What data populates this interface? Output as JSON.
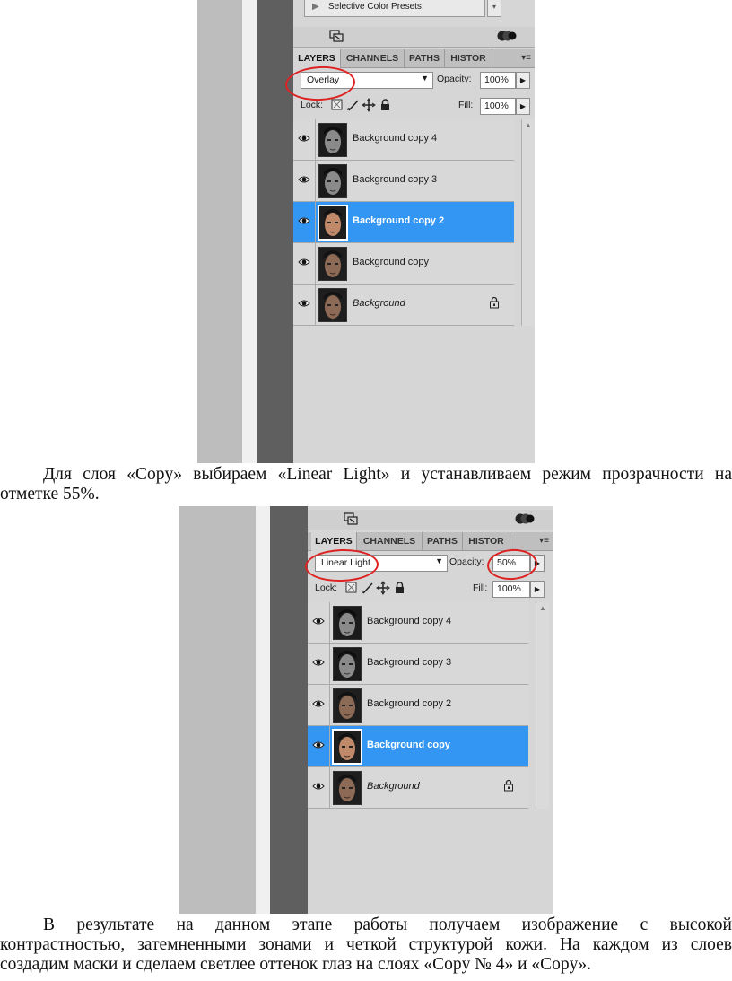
{
  "screenshot1": {
    "preset_label": "Selective Color Presets",
    "tabs": [
      "LAYERS",
      "CHANNELS",
      "PATHS",
      "HISTOR"
    ],
    "tab_menu": "▾≡",
    "blend_mode": "Overlay",
    "opacity_label": "Opacity:",
    "opacity_value": "100%",
    "lock_label": "Lock:",
    "fill_label": "Fill:",
    "fill_value": "100%",
    "layers": [
      {
        "name": "Background copy 4",
        "selected": false
      },
      {
        "name": "Background copy 3",
        "selected": false
      },
      {
        "name": "Background copy 2",
        "selected": true
      },
      {
        "name": "Background copy",
        "selected": false
      },
      {
        "name": "Background",
        "selected": false,
        "locked": true
      }
    ]
  },
  "paragraph1": {
    "line1": "Для слоя «Copy» выбираем «Linear Light» и устанавливаем режим прозрачности на",
    "line2": "отметке 55%."
  },
  "screenshot2": {
    "tabs": [
      "LAYERS",
      "CHANNELS",
      "PATHS",
      "HISTOR"
    ],
    "tab_menu": "▾≡",
    "blend_mode": "Linear Light",
    "opacity_label": "Opacity:",
    "opacity_value": "50%",
    "lock_label": "Lock:",
    "fill_label": "Fill:",
    "fill_value": "100%",
    "layers": [
      {
        "name": "Background copy 4",
        "selected": false
      },
      {
        "name": "Background copy 3",
        "selected": false
      },
      {
        "name": "Background copy 2",
        "selected": false
      },
      {
        "name": "Background copy",
        "selected": true
      },
      {
        "name": "Background",
        "selected": false,
        "locked": true
      }
    ]
  },
  "paragraph2": {
    "line1": "В результате на данном этапе работы получаем изображение с высокой",
    "line2": "контрастностью, затемненными зонами и четкой структурой кожи. На каждом из слоев",
    "line3": "создадим маски и сделаем светлее оттенок глаз на слоях «Copy № 4» и «Copy»."
  },
  "colors": {
    "selected_layer": "#3396f3",
    "annotation_ring": "#d22222",
    "panel_bg": "#d6d6d6",
    "dark_strip": "#5f5f5f"
  },
  "icons": [
    "visibility-eye-icon",
    "lock-icon",
    "brush-icon",
    "move-icon",
    "transparency-lock-icon",
    "dropdown-arrow-icon",
    "panel-menu-icon"
  ]
}
